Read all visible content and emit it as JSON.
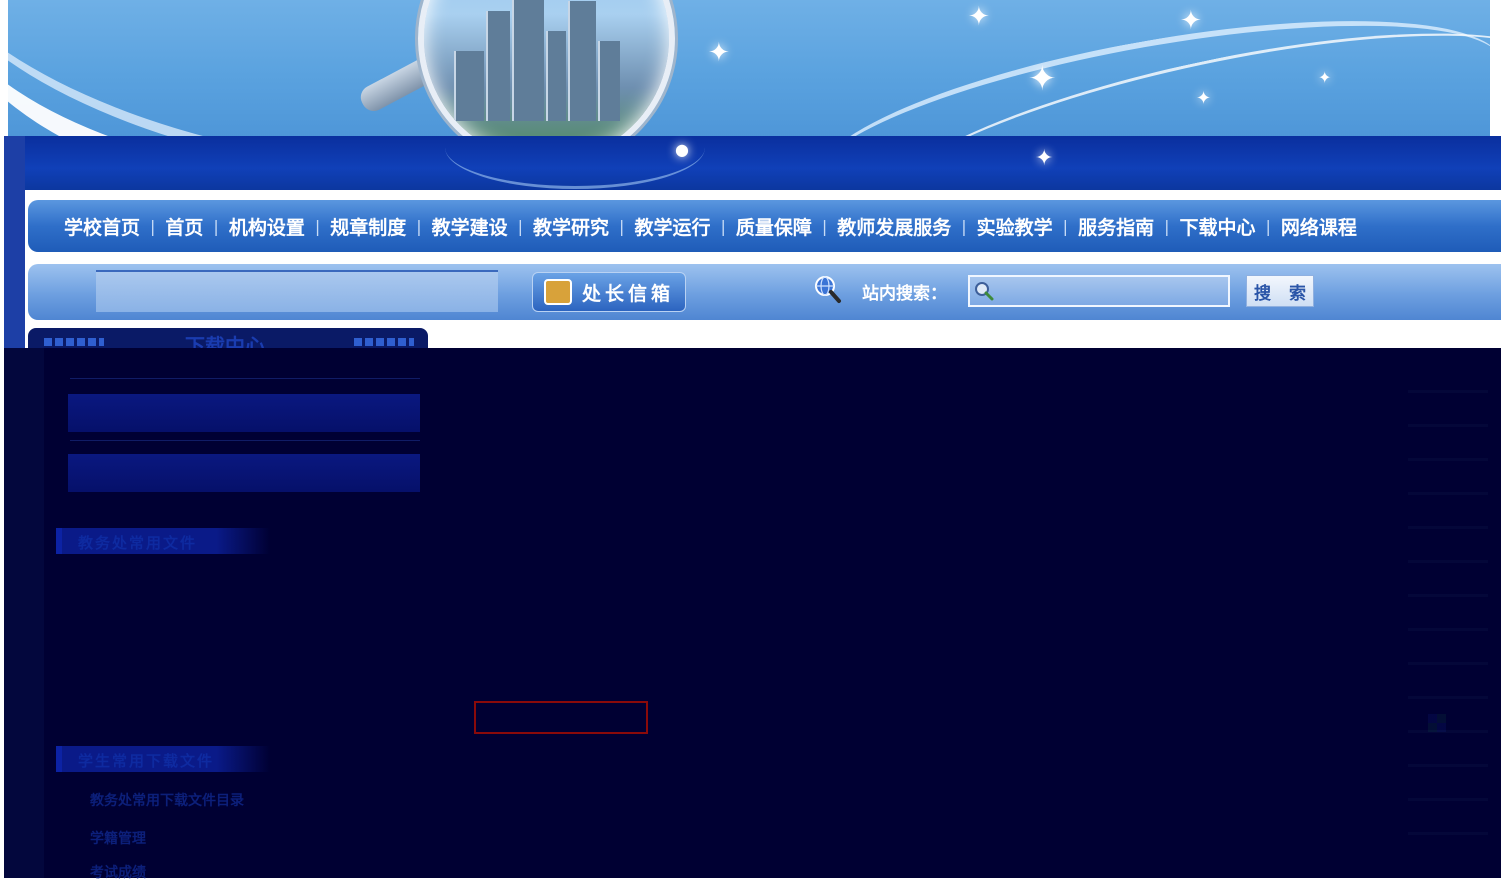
{
  "nav": {
    "items": [
      "学校首页",
      "首页",
      "机构设置",
      "规章制度",
      "教学建设",
      "教学研究",
      "教学运行",
      "质量保障",
      "教师发展服务",
      "实验教学",
      "服务指南",
      "下载中心",
      "网络课程"
    ],
    "separator": "|"
  },
  "toolbar": {
    "mailbox_label": "处长信箱",
    "search_label": "站内搜索：",
    "search_value": "",
    "search_button": "搜 索"
  },
  "sidebar": {
    "title": "下载中心"
  },
  "sections": {
    "section1_title": "教务处常用文件",
    "section2_title": "学生常用下载文件",
    "links": [
      "教务处常用下载文件目录",
      "学籍管理",
      "考试成绩"
    ]
  },
  "colors": {
    "banner_sky": "#5aa2df",
    "band_blue": "#1040b8",
    "nav_blue": "#2f6fc9",
    "dark_overlay": "#000033",
    "highlight_box": "#8a0a0a"
  },
  "icons": [
    "magnifier-lens-icon",
    "mailbox-icon",
    "search-globe-icon",
    "search-field-icon",
    "qr-code-icon"
  ]
}
